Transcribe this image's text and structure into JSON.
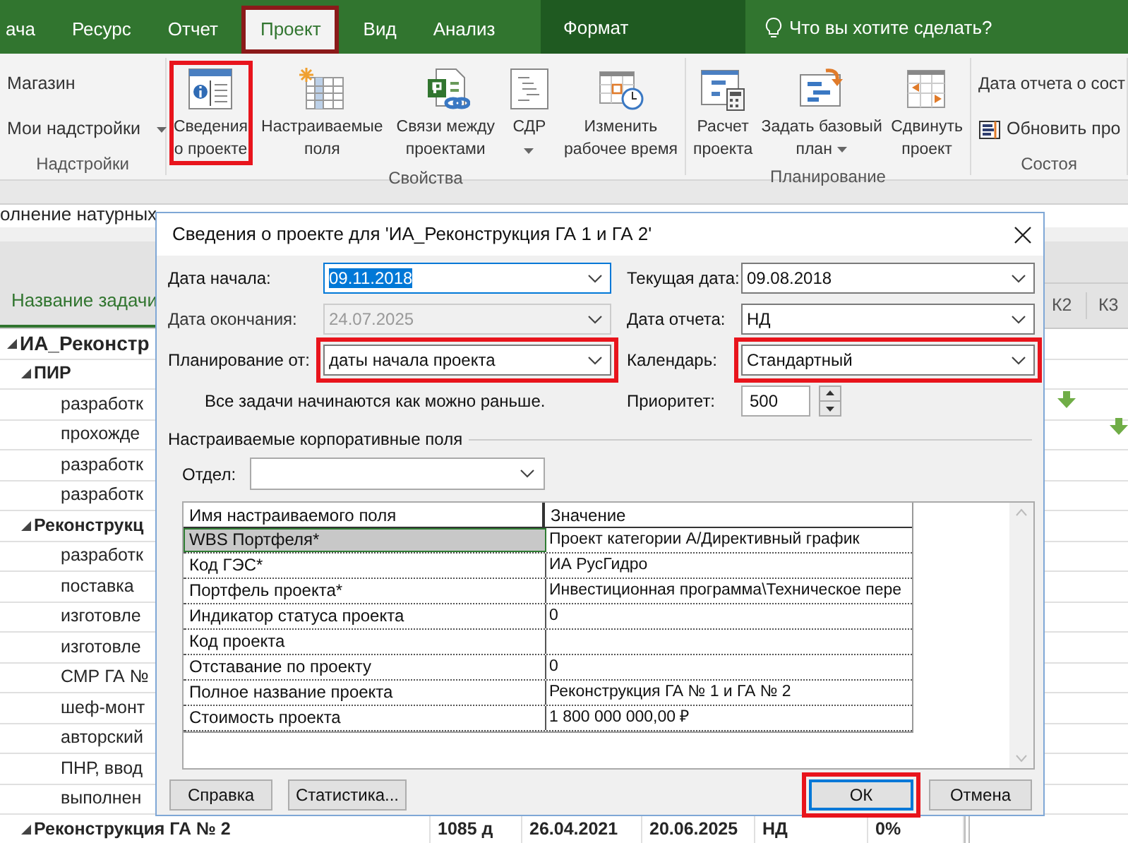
{
  "ribbon_tabs": [
    {
      "label": "ача",
      "selected": false,
      "highlighted": false
    },
    {
      "label": "Ресурс",
      "selected": false,
      "highlighted": false
    },
    {
      "label": "Отчет",
      "selected": false,
      "highlighted": false
    },
    {
      "label": "Проект",
      "selected": true,
      "highlighted": true
    },
    {
      "label": "Вид",
      "selected": false,
      "highlighted": false
    },
    {
      "label": "Анализ",
      "selected": false,
      "highlighted": false
    }
  ],
  "contextual_tab": {
    "label": "Формат"
  },
  "tell_me": {
    "text": "Что вы хотите сделать?"
  },
  "ribbon_groups": [
    {
      "label": "Надстройки",
      "items": [
        {
          "kind": "small",
          "label": "Магазин",
          "dropdown": false,
          "highlighted": false
        },
        {
          "kind": "small",
          "label": "Мои надстройки",
          "dropdown": true,
          "highlighted": false
        }
      ]
    },
    {
      "label": "Свойства",
      "items": [
        {
          "kind": "large",
          "lines": [
            "Сведения",
            "о проекте"
          ],
          "dropdown": false,
          "highlighted": true
        },
        {
          "kind": "large",
          "lines": [
            "Настраиваемые",
            "поля"
          ],
          "dropdown": false,
          "highlighted": false
        },
        {
          "kind": "large",
          "lines": [
            "Связи между",
            "проектами"
          ],
          "dropdown": false,
          "highlighted": false
        },
        {
          "kind": "large",
          "lines": [
            "СДР"
          ],
          "dropdown": true,
          "highlighted": false
        },
        {
          "kind": "large",
          "lines": [
            "Изменить",
            "рабочее время"
          ],
          "dropdown": false,
          "highlighted": false
        }
      ]
    },
    {
      "label": "Планирование",
      "items": [
        {
          "kind": "large",
          "lines": [
            "Расчет",
            "проекта"
          ],
          "dropdown": false,
          "highlighted": false
        },
        {
          "kind": "large",
          "lines": [
            "Задать базовый",
            "план"
          ],
          "dropdown": true,
          "highlighted": false
        },
        {
          "kind": "large",
          "lines": [
            "Сдвинуть",
            "проект"
          ],
          "dropdown": false,
          "highlighted": false
        }
      ]
    },
    {
      "label": "Состоя",
      "items": [
        {
          "kind": "text",
          "label": "Дата отчета о сост"
        },
        {
          "kind": "small",
          "label": "Обновить про",
          "dropdown": false,
          "highlighted": false
        }
      ]
    }
  ],
  "entry_bar": {
    "text": "олнение натурных"
  },
  "task_sheet": {
    "name_column": "Название задачи",
    "rows": [
      {
        "name": "ИА_Реконстр",
        "summary": true,
        "expanded": true,
        "children": [
          {
            "name": "ПИР",
            "summary": true,
            "expanded": true,
            "children": [
              {
                "name": "разработк",
                "summary": false
              },
              {
                "name": "прохожде",
                "summary": false
              },
              {
                "name": "разработк",
                "summary": false
              },
              {
                "name": "разработк",
                "summary": false
              }
            ]
          },
          {
            "name": "Реконструкц",
            "summary": true,
            "expanded": true,
            "children": [
              {
                "name": "разработк",
                "summary": false
              },
              {
                "name": "поставка",
                "summary": false
              },
              {
                "name": "изготовле",
                "summary": false
              },
              {
                "name": "изготовле",
                "summary": false
              },
              {
                "name": "СМР ГА №",
                "summary": false
              },
              {
                "name": "шеф-монт",
                "summary": false
              },
              {
                "name": "авторский",
                "summary": false
              },
              {
                "name": "ПНР, ввод",
                "summary": false
              },
              {
                "name": "выполнен",
                "summary": false
              }
            ]
          },
          {
            "name": "Реконструкция ГА № 2",
            "summary": true,
            "expanded": true,
            "cells": [
              "1085 д",
              "26.04.2021",
              "20.06.2025",
              "НД",
              "0%"
            ]
          }
        ]
      }
    ]
  },
  "gantt": {
    "columns": [
      "К2",
      "К3"
    ]
  },
  "dialog": {
    "title": "Сведения о проекте для 'ИА_Реконструкция ГА 1 и ГА 2'",
    "left_fields": [
      {
        "label": "Дата начала:",
        "value": "09.11.2018",
        "disabled": false,
        "focused": true,
        "highlighted": false
      },
      {
        "label": "Дата окончания:",
        "value": "24.07.2025",
        "disabled": true,
        "focused": false,
        "highlighted": false
      },
      {
        "label": "Планирование от:",
        "value": "даты начала проекта",
        "disabled": false,
        "focused": false,
        "highlighted": true
      }
    ],
    "right_fields": [
      {
        "kind": "combo",
        "label": "Текущая дата:",
        "value": "09.08.2018",
        "disabled": false,
        "focused": false,
        "highlighted": false
      },
      {
        "kind": "combo",
        "label": "Дата отчета:",
        "value": "НД",
        "disabled": false,
        "focused": false,
        "highlighted": false
      },
      {
        "kind": "combo",
        "label": "Календарь:",
        "value": "Стандартный",
        "disabled": false,
        "focused": false,
        "highlighted": true
      },
      {
        "kind": "spin",
        "label": "Приоритет:",
        "value": "500",
        "disabled": false,
        "focused": false,
        "highlighted": false
      }
    ],
    "note": "Все задачи начинаются как можно раньше.",
    "section": "Настраиваемые корпоративные поля",
    "department": {
      "label": "Отдел:"
    },
    "custom_fields": {
      "columns": [
        "Имя настраиваемого поля",
        "Значение"
      ],
      "rows": [
        {
          "name": "WBS Портфеля*",
          "value": "Проект категории А/Директивный график",
          "selected": true
        },
        {
          "name": "Код ГЭС*",
          "value": "ИА РусГидро",
          "selected": false
        },
        {
          "name": "Портфель проекта*",
          "value": "Инвестиционная программа\\Техническое пере",
          "selected": false
        },
        {
          "name": "Индикатор статуса проекта",
          "value": "0",
          "selected": false
        },
        {
          "name": "Код проекта",
          "selected": false
        },
        {
          "name": "Отставание по проекту",
          "value": "0",
          "selected": false
        },
        {
          "name": "Полное название проекта",
          "value": "Реконструкция ГА № 1 и ГА № 2",
          "selected": false
        },
        {
          "name": "Стоимость проекта",
          "value": "1 800 000 000,00 ₽",
          "selected": false
        }
      ]
    },
    "left_buttons": [
      {
        "label": "Справка",
        "default": false,
        "highlighted": false
      },
      {
        "label": "Статистика...",
        "default": false,
        "highlighted": false
      }
    ],
    "right_buttons": [
      {
        "label": "ОК",
        "default": true,
        "highlighted": true
      },
      {
        "label": "Отмена",
        "default": false,
        "highlighted": false
      }
    ]
  }
}
